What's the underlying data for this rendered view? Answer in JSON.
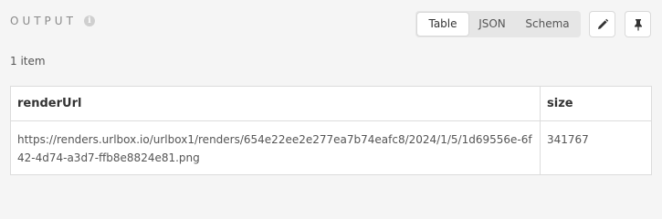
{
  "header": {
    "title": "OUTPUT",
    "info_icon": "info-icon"
  },
  "view_switch": {
    "options": [
      "Table",
      "JSON",
      "Schema"
    ],
    "selected": "Table"
  },
  "actions": {
    "edit_icon": "pencil-icon",
    "pin_icon": "pin-icon"
  },
  "summary": {
    "count_text": "1 item"
  },
  "table": {
    "columns": [
      "renderUrl",
      "size"
    ],
    "rows": [
      [
        "https://renders.urlbox.io/urlbox1/renders/654e22ee2e277ea7b74eafc8/2024/1/5/1d69556e-6f42-4d74-a3d7-ffb8e8824e81.png",
        "341767"
      ]
    ]
  }
}
